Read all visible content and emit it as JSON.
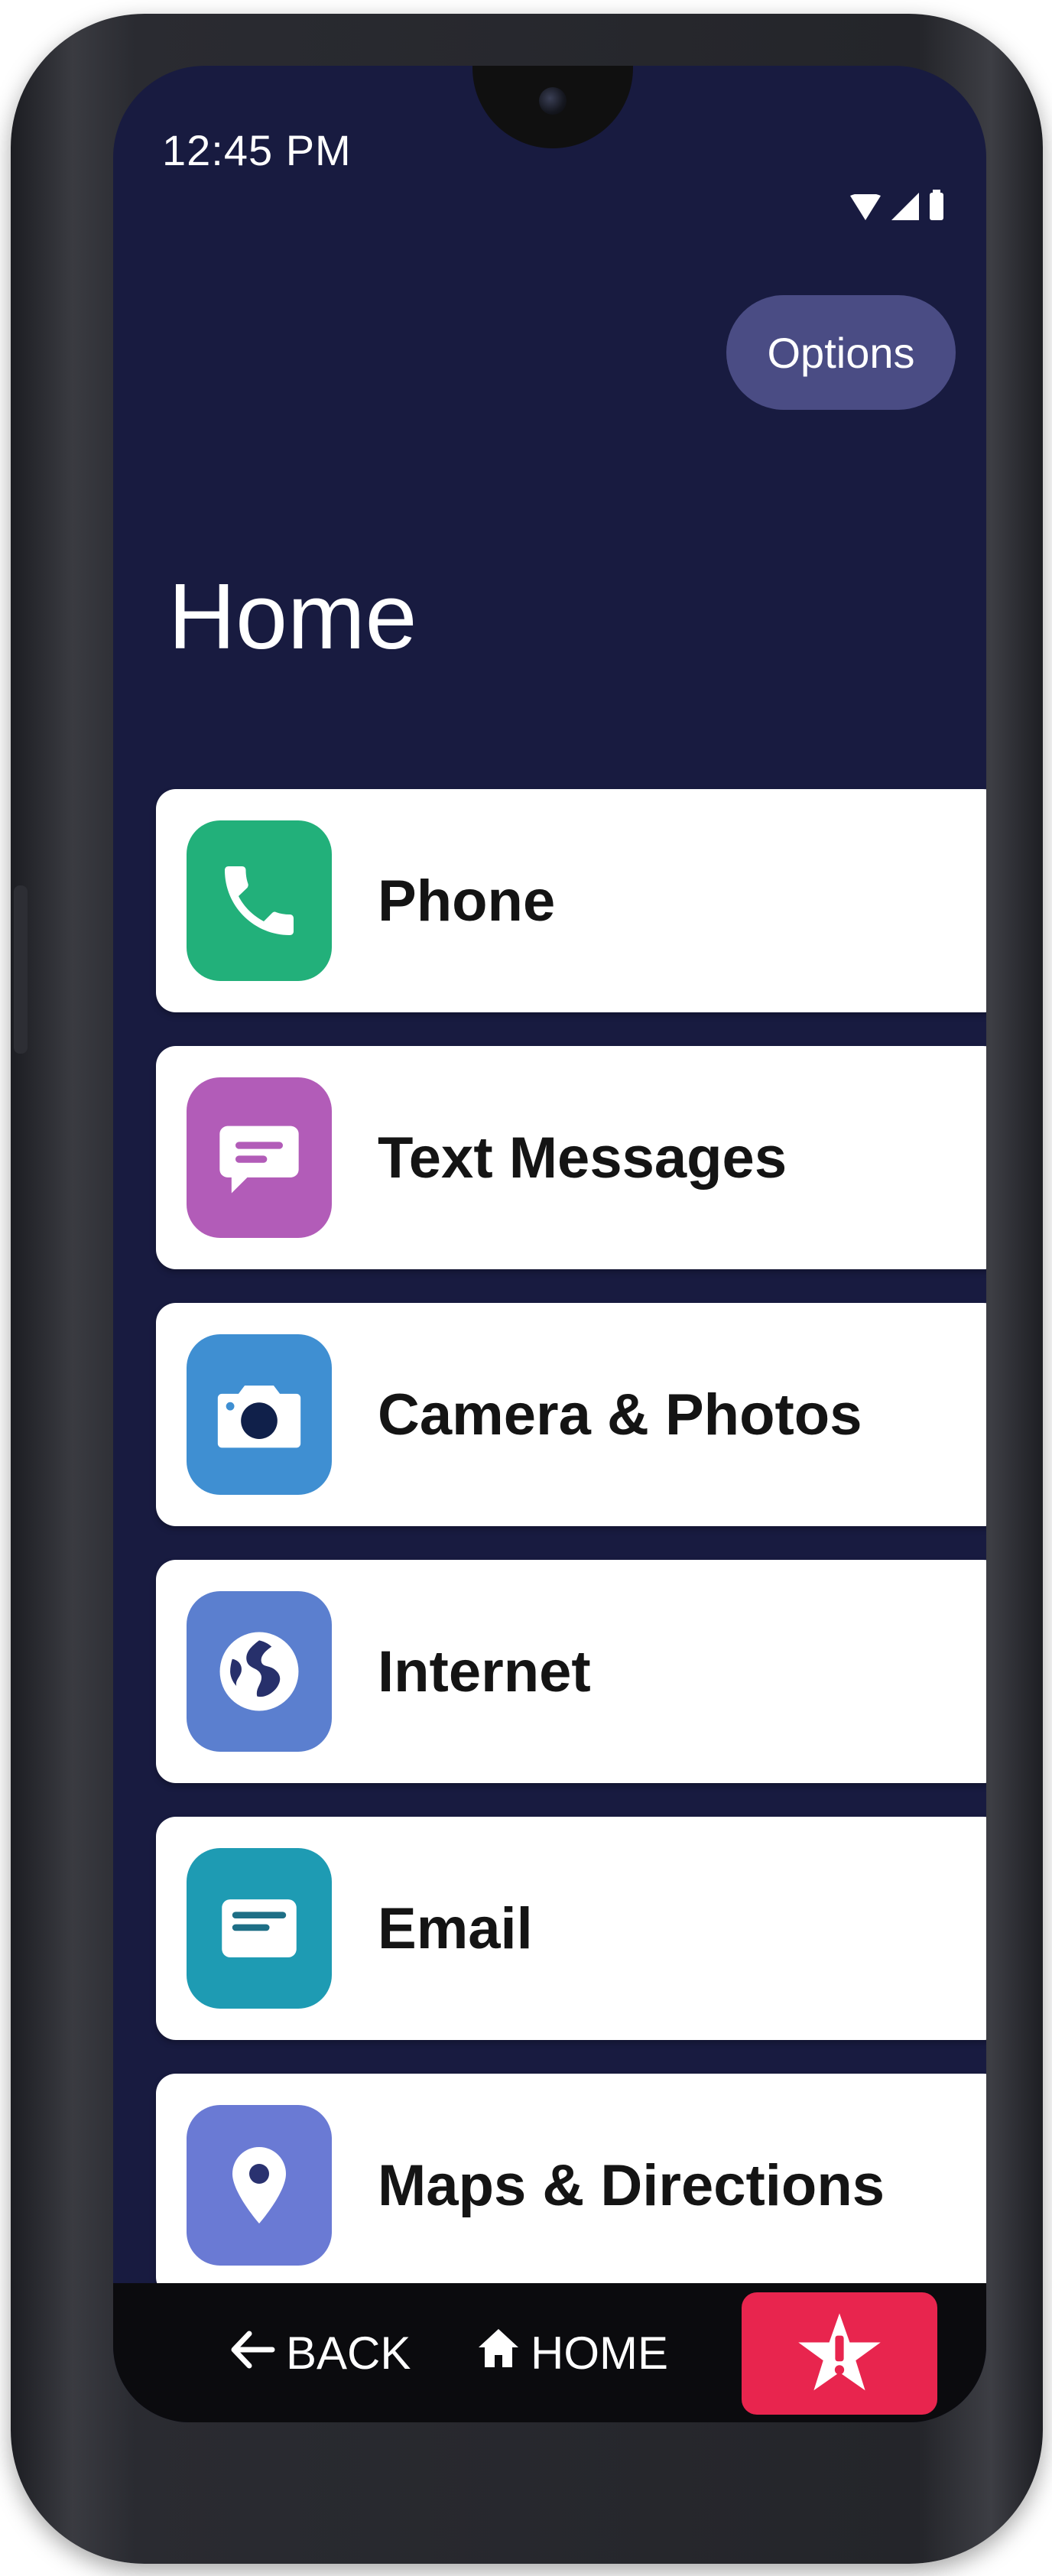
{
  "status_bar": {
    "time": "12:45 PM"
  },
  "header": {
    "options_label": "Options",
    "title": "Home"
  },
  "apps": [
    {
      "label": "Phone",
      "icon": "phone-icon",
      "color": "#22b07a"
    },
    {
      "label": "Text Messages",
      "icon": "message-icon",
      "color": "#b25cb8"
    },
    {
      "label": "Camera & Photos",
      "icon": "camera-icon",
      "color": "#3f8fd2"
    },
    {
      "label": "Internet",
      "icon": "globe-icon",
      "color": "#5b7fcf"
    },
    {
      "label": "Email",
      "icon": "envelope-icon",
      "color": "#1e9bb3"
    },
    {
      "label": "Maps & Directions",
      "icon": "map-pin-icon",
      "color": "#6a7ad4"
    }
  ],
  "nav": {
    "back_label": "BACK",
    "home_label": "HOME",
    "sos_icon": "urgent-response-star-icon",
    "sos_color": "#e8254e"
  },
  "colors": {
    "screen_background": "#181b40",
    "options_button": "#4a4c84"
  }
}
